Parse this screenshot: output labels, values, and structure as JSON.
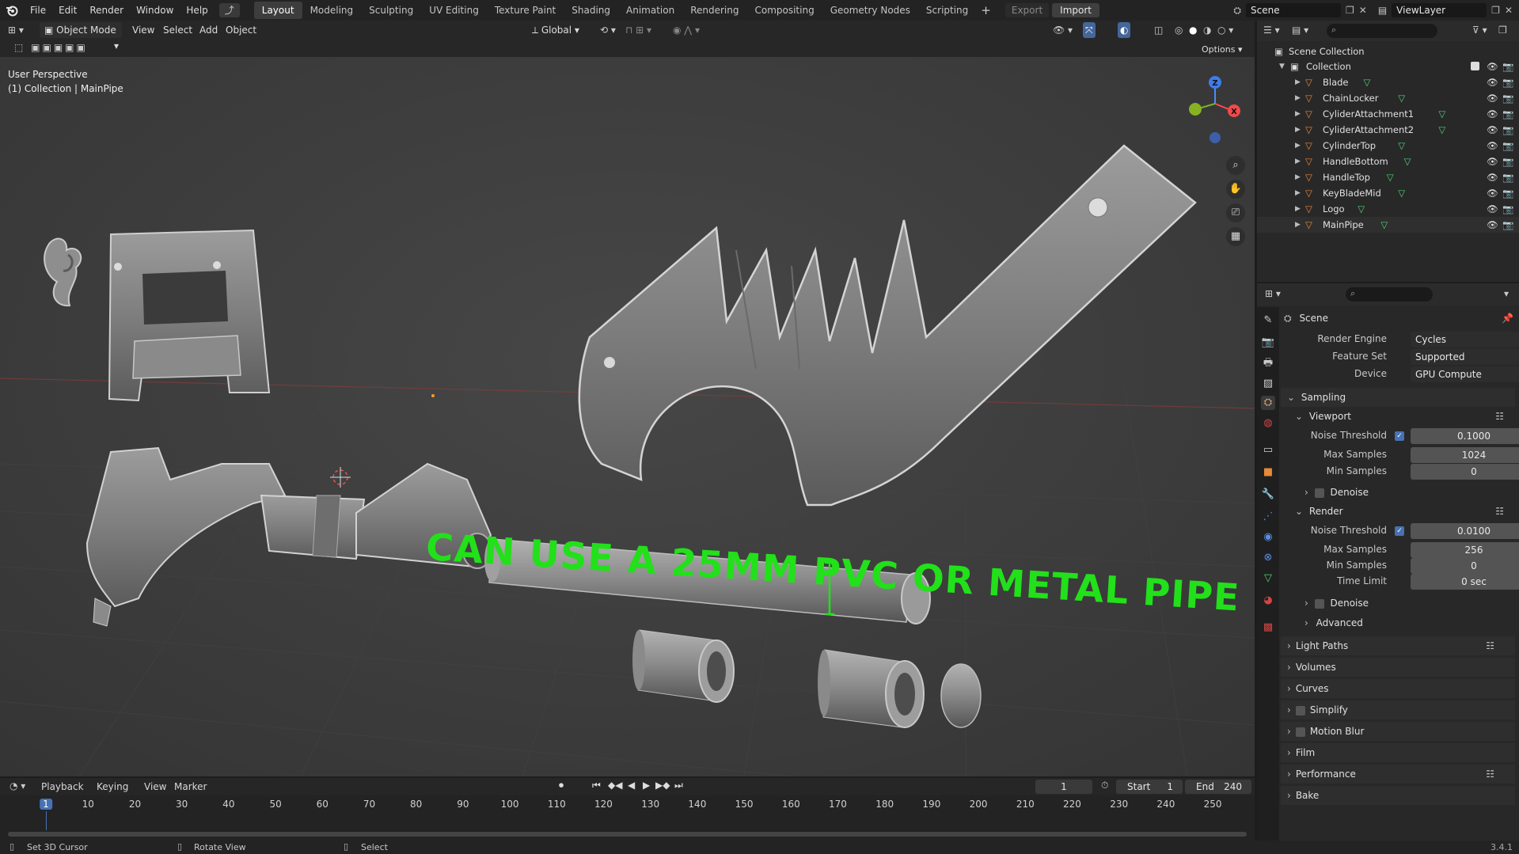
{
  "topbar": {
    "menus": [
      "File",
      "Edit",
      "Render",
      "Window",
      "Help"
    ],
    "workspaces": [
      "Layout",
      "Modeling",
      "Sculpting",
      "UV Editing",
      "Texture Paint",
      "Shading",
      "Animation",
      "Rendering",
      "Compositing",
      "Geometry Nodes",
      "Scripting"
    ],
    "active_workspace": "Layout",
    "export_label": "Export",
    "import_label": "Import",
    "scene_name": "Scene",
    "view_layer": "ViewLayer"
  },
  "viewport_header": {
    "mode": "Object Mode",
    "menus": [
      "View",
      "Select",
      "Add",
      "Object"
    ],
    "transform_orientation": "Global",
    "options_label": "Options"
  },
  "viewport": {
    "perspective_label": "User Perspective",
    "collection_label": "(1) Collection | MainPipe",
    "overlay_text": "CAN USE A 25MM PVC OR METAL PIPE",
    "overlay_color": "#22e01a",
    "axis_labels": {
      "z": "Z",
      "x": "X",
      "y": "Y"
    }
  },
  "outliner": {
    "root": "Scene Collection",
    "collection": "Collection",
    "objects": [
      "Blade",
      "ChainLocker",
      "CyliderAttachment1",
      "CyliderAttachment2",
      "CylinderTop",
      "HandleBottom",
      "HandleTop",
      "KeyBladeMid",
      "Logo",
      "MainPipe"
    ]
  },
  "properties": {
    "title": "Scene",
    "render_engine_label": "Render Engine",
    "render_engine": "Cycles",
    "feature_set_label": "Feature Set",
    "feature_set": "Supported",
    "device_label": "Device",
    "device": "GPU Compute",
    "sampling": "Sampling",
    "viewport": "Viewport",
    "noise_threshold_label": "Noise Threshold",
    "viewport_noise_threshold": "0.1000",
    "max_samples_label": "Max Samples",
    "viewport_max_samples": "1024",
    "min_samples_label": "Min Samples",
    "viewport_min_samples": "0",
    "denoise": "Denoise",
    "render": "Render",
    "render_noise_threshold": "0.0100",
    "render_max_samples": "256",
    "render_min_samples": "0",
    "time_limit_label": "Time Limit",
    "time_limit": "0 sec",
    "advanced": "Advanced",
    "panels": [
      "Light Paths",
      "Volumes",
      "Curves",
      "Simplify",
      "Motion Blur",
      "Film",
      "Performance",
      "Bake"
    ]
  },
  "timeline": {
    "menus": [
      "Playback",
      "Keying",
      "View",
      "Marker"
    ],
    "current_frame": "1",
    "start_label": "Start",
    "start": "1",
    "end_label": "End",
    "end": "240",
    "ticks": [
      "1",
      "10",
      "20",
      "30",
      "40",
      "50",
      "60",
      "70",
      "80",
      "90",
      "100",
      "110",
      "120",
      "130",
      "140",
      "150",
      "160",
      "170",
      "180",
      "190",
      "200",
      "210",
      "220",
      "230",
      "240",
      "250"
    ]
  },
  "statusbar": {
    "left": "Set 3D Cursor",
    "middle": "Rotate View",
    "right": "Select",
    "version": "3.4.1"
  },
  "colors": {
    "accent_blue": "#4772b3",
    "object_orange": "#e8883a",
    "mesh_green": "#4fd17a",
    "overlay_green": "#22e01a"
  }
}
